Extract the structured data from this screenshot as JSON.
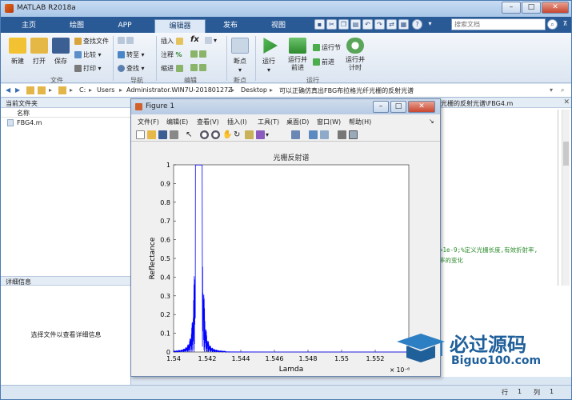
{
  "app": {
    "title": "MATLAB R2018a",
    "accent": "#2a5a96"
  },
  "tabs": [
    "主页",
    "绘图",
    "APP",
    "编辑器",
    "发布",
    "视图"
  ],
  "active_tab": "编辑器",
  "search": {
    "placeholder": "搜索文档"
  },
  "ribbon": {
    "file": {
      "new": "新建",
      "open": "打开",
      "save": "保存",
      "find_files": "查找文件",
      "compare": "比较",
      "print": "打印",
      "group": "文件"
    },
    "nav": {
      "goto": "转至",
      "find": "查找",
      "group": "导航"
    },
    "edit": {
      "insert": "插入",
      "comment": "注释",
      "indent": "缩进",
      "fx": "fx",
      "group": "编辑"
    },
    "breakpoint": {
      "label": "断点",
      "group": "断点"
    },
    "run": {
      "run": "运行",
      "run_advance": "运行并\n前进",
      "run_section": "运行节",
      "advance": "前进",
      "run_time": "运行并\n计时",
      "group": "运行"
    }
  },
  "address": {
    "path": [
      "C:",
      "Users",
      "Administrator.WIN7U-20180127Z",
      "Desktop",
      "可以正确仿真出FBG布拉格光纤光栅的反射光谱"
    ]
  },
  "left_panel": {
    "title": "当前文件夹",
    "column": "名称",
    "file": "FBG4.m",
    "detail_title": "详细信息",
    "detail_text": "选择文件以查看详细信息"
  },
  "editor": {
    "tab": "光栅的反射光谱\\FBG4.m",
    "code1": "=1e-9;%定义光栅长度,有效折射率,",
    "code2": "率的变化"
  },
  "status": {
    "row_label": "行",
    "row": "1",
    "col_label": "列",
    "col": "1"
  },
  "figure": {
    "title": "Figure 1",
    "menu": [
      "文件(F)",
      "编辑(E)",
      "查看(V)",
      "插入(I)",
      "工具(T)",
      "桌面(D)",
      "窗口(W)",
      "帮助(H)"
    ]
  },
  "chart_data": {
    "type": "line",
    "title": "光栅反射谱",
    "xlabel": "Lamda",
    "ylabel": "Reflectance",
    "x_multiplier": "× 10⁻⁶",
    "xlim": [
      1.54,
      1.554
    ],
    "ylim": [
      0,
      1
    ],
    "xticks": [
      "1.54",
      "1.542",
      "1.544",
      "1.546",
      "1.548",
      "1.55",
      "1.552"
    ],
    "yticks": [
      "0",
      "0.1",
      "0.2",
      "0.3",
      "0.4",
      "0.5",
      "0.6",
      "0.7",
      "0.8",
      "0.9",
      "1"
    ],
    "peak_center": 1.5415,
    "peak_width": 0.0002,
    "series": [
      {
        "color": "#0000ff"
      }
    ]
  },
  "watermark": {
    "brand": "必过源码",
    "url": "Biguo100.com"
  }
}
